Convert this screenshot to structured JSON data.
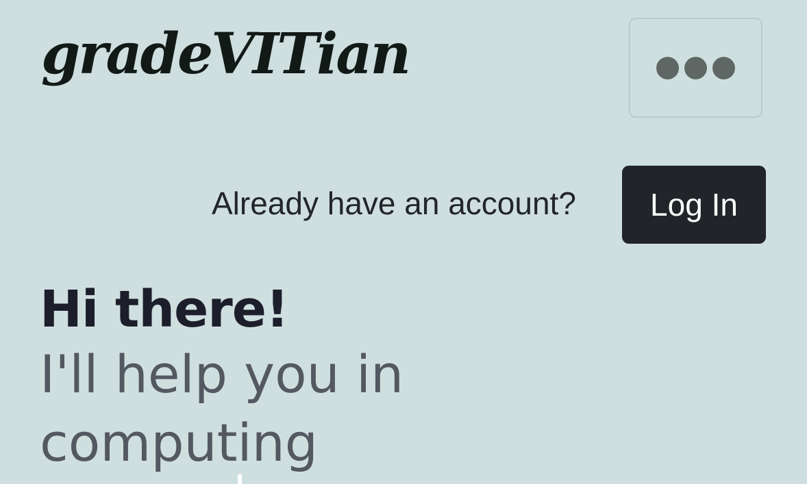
{
  "header": {
    "brand": "gradeVITian",
    "menu_icon": "more-horizontal-icon"
  },
  "account": {
    "prompt": "Already have an account?",
    "login_label": "Log In"
  },
  "hero": {
    "title": "Hi there!",
    "subtitle_line1": "I'll help you in",
    "subtitle_line2": "computing"
  },
  "colors": {
    "background": "#cfdfdf",
    "login_button": "#212529",
    "title_text": "#1d1e2c",
    "subtitle_text": "#545861"
  }
}
